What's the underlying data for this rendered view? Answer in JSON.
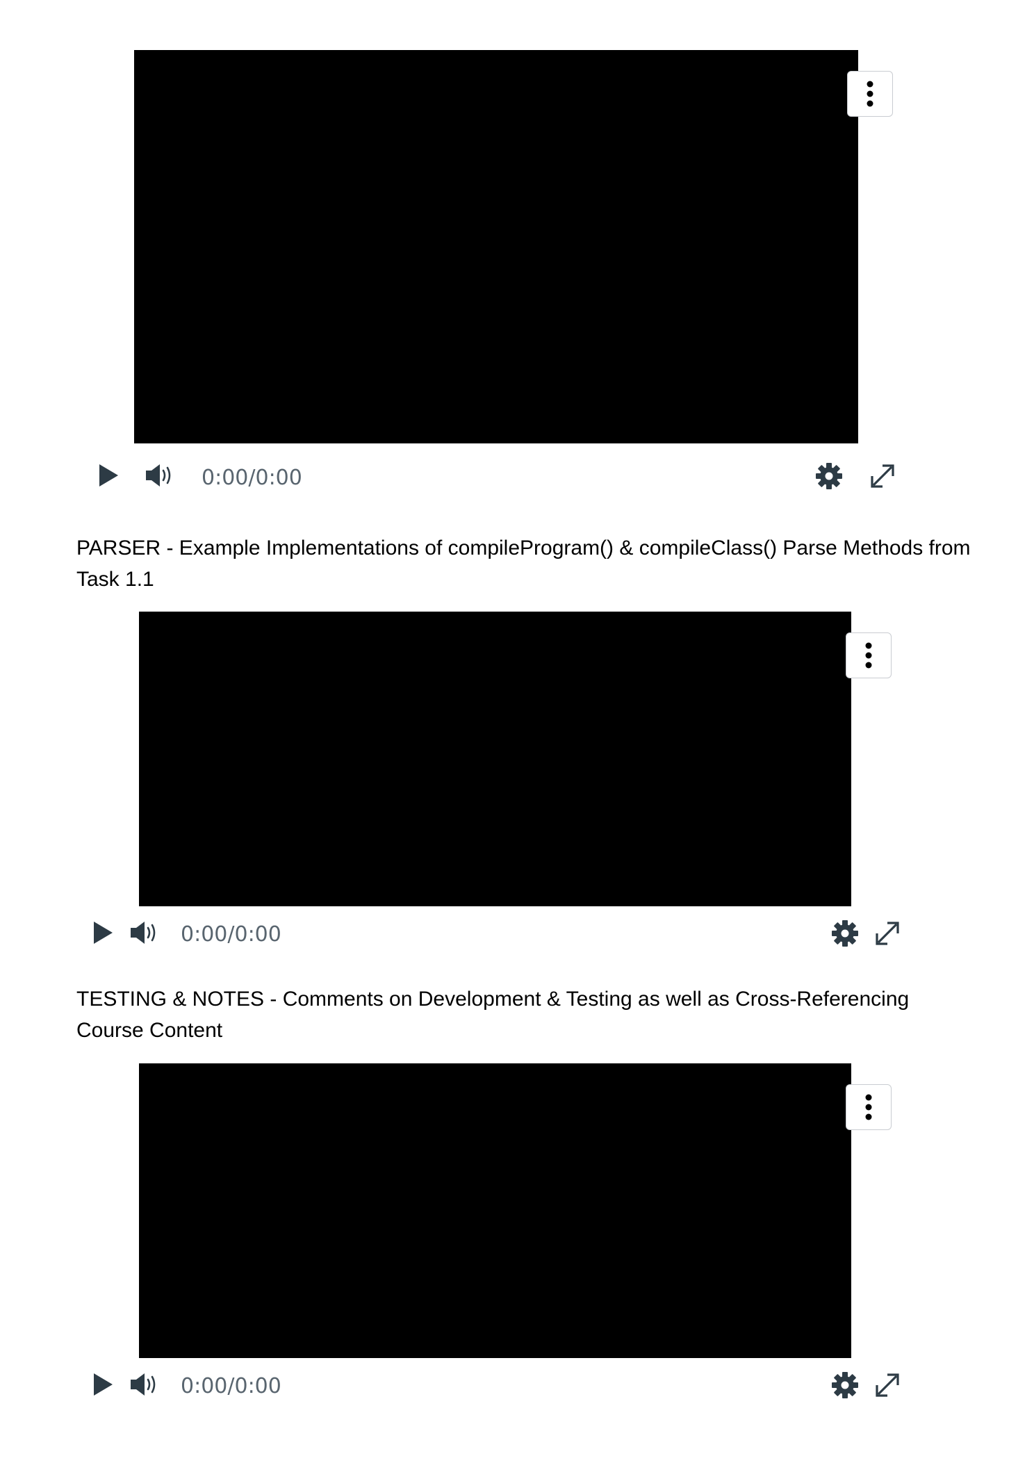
{
  "players": [
    {
      "time_label": "0:00/0:00",
      "icons": {
        "more": "vertical-ellipsis-icon",
        "play": "play-icon",
        "volume": "volume-icon",
        "settings": "gear-icon",
        "fullscreen": "expand-icon"
      }
    },
    {
      "caption": "PARSER - Example Implementations of compileProgram() & compileClass() Parse Methods from Task 1.1",
      "time_label": "0:00/0:00",
      "icons": {
        "more": "vertical-ellipsis-icon",
        "play": "play-icon",
        "volume": "volume-icon",
        "settings": "gear-icon",
        "fullscreen": "expand-icon"
      }
    },
    {
      "caption": "TESTING & NOTES - Comments on Development & Testing as well as Cross-Referencing Course Content",
      "time_label": "0:00/0:00",
      "icons": {
        "more": "vertical-ellipsis-icon",
        "play": "play-icon",
        "volume": "volume-icon",
        "settings": "gear-icon",
        "fullscreen": "expand-icon"
      }
    }
  ],
  "colors": {
    "video_background": "#000000",
    "control_icon": "#2d3b45",
    "time_text": "#59656f",
    "caption_text": "#000000"
  }
}
